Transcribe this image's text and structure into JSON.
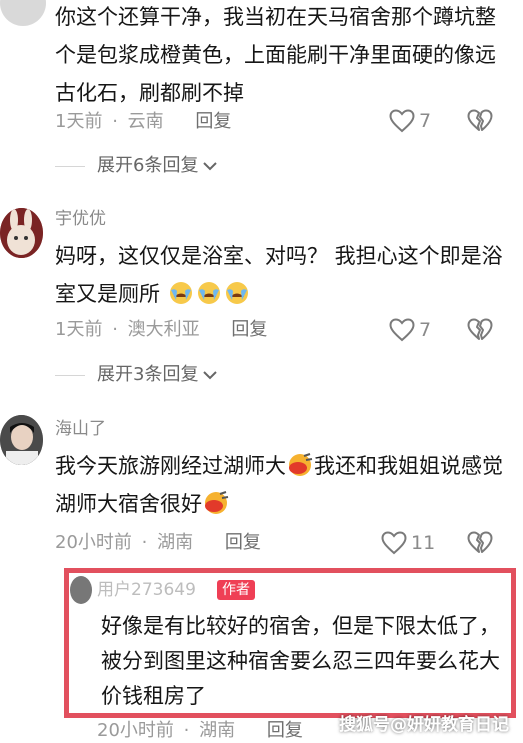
{
  "comments": [
    {
      "username": "",
      "text": "你这个还算干净，我当初在天马宿舍那个蹲坑整个是包浆成橙黄色，上面能刷干净里面硬的像远古化石，刷都刷不掉",
      "time": "1天前",
      "location": "云南",
      "reply_label": "回复",
      "likes": "7",
      "expand_label": "展开6条回复"
    },
    {
      "username": "宇优优",
      "text": "妈呀，这仅仅是浴室、对吗？ 我担心这个即是浴室又是厕所",
      "emoji_count": 3,
      "time": "1天前",
      "location": "澳大利亚",
      "reply_label": "回复",
      "likes": "7",
      "expand_label": "展开3条回复"
    },
    {
      "username": "海山了",
      "text_part1": "我今天旅游刚经过湖师大",
      "text_part2": "我还和我姐姐说感觉湖师大宿舍很好",
      "time": "20小时前",
      "location": "湖南",
      "reply_label": "回复",
      "likes": "11"
    }
  ],
  "author_reply": {
    "username": "用户273649",
    "badge": "作者",
    "text": "好像是有比较好的宿舍，但是下限太低了，被分到图里这种宿舍要么忍三四年要么花大价钱租房了",
    "time": "20小时前",
    "location": "湖南",
    "reply_label": "回复"
  },
  "meta_separator": "·",
  "watermark": "搜狐号@妍妍教育日记",
  "colors": {
    "author_highlight_border": "#e2505e",
    "author_badge": "#ef3f55"
  },
  "icons": [
    "heart-icon",
    "dislike-icon",
    "chevron-down-icon",
    "crying-emoji-icon",
    "laughing-emoji-icon"
  ]
}
